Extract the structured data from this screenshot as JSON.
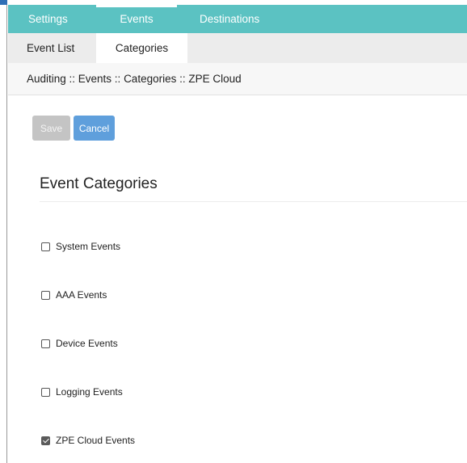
{
  "top_nav": {
    "tabs": [
      "Settings",
      "Events",
      "Destinations"
    ],
    "active": "Events"
  },
  "sub_nav": {
    "tabs": [
      "Event List",
      "Categories"
    ],
    "active": "Categories"
  },
  "breadcrumb": "Auditing :: Events :: Categories :: ZPE Cloud",
  "buttons": {
    "save": "Save",
    "cancel": "Cancel"
  },
  "section_title": "Event Categories",
  "categories": [
    {
      "label": "System Events",
      "checked": false
    },
    {
      "label": "AAA Events",
      "checked": false
    },
    {
      "label": "Device Events",
      "checked": false
    },
    {
      "label": "Logging Events",
      "checked": false
    },
    {
      "label": "ZPE Cloud Events",
      "checked": true
    }
  ],
  "colors": {
    "nav": "#5bc2c2",
    "cancel": "#5f9fdc",
    "save_disabled": "#c4c4c4"
  }
}
